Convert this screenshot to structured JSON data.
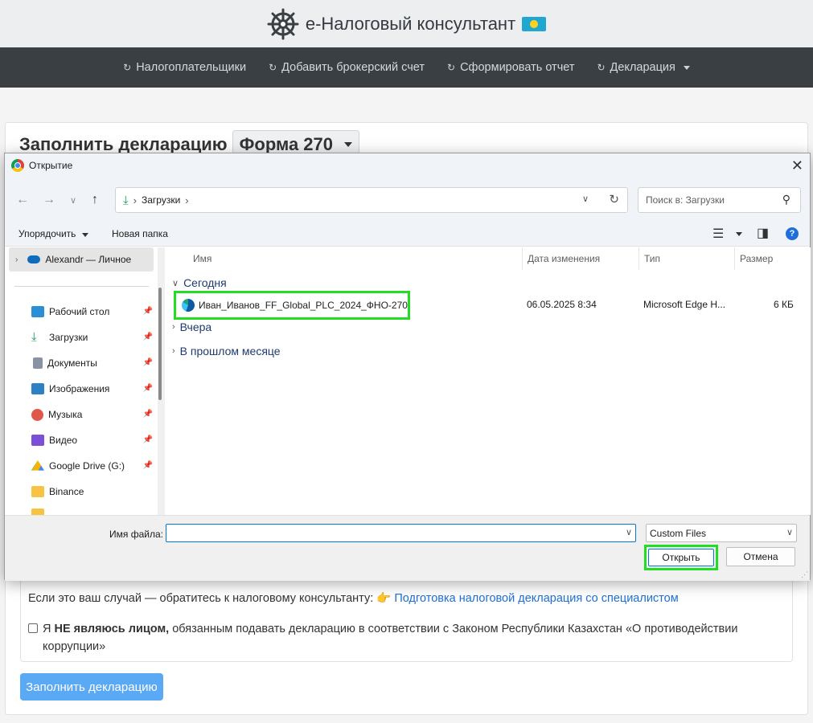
{
  "site": {
    "brand": "e-Налоговый консультант",
    "nav": [
      {
        "label": "Налогоплательщики"
      },
      {
        "label": "Добавить брокерский счет"
      },
      {
        "label": "Сформировать отчет"
      },
      {
        "label": "Декларация"
      }
    ],
    "page_title": "Заполнить декларацию",
    "form_select": "Форма 270",
    "info_text": "Если это ваш случай — обратитесь к налоговому консультанту: 👉",
    "info_link": "Подготовка налоговой декларация со специалистом",
    "checkbox_bold": "НЕ являюсь лицом,",
    "checkbox_prefix": "Я",
    "checkbox_text": "обязанным подавать декларацию в соответствии с Законом Республики Казахстан «О противодействии коррупции»",
    "submit_label": "Заполнить декларацию"
  },
  "dialog": {
    "title": "Открытие",
    "address_path": "Загрузки",
    "search_placeholder": "Поиск в: Загрузки",
    "organize_label": "Упорядочить",
    "new_folder_label": "Новая папка",
    "nav_pane": {
      "onedrive": "Alexandr — Личное",
      "items": [
        {
          "label": "Рабочий стол",
          "color": "#2b8fd6"
        },
        {
          "label": "Загрузки",
          "color": "#1a9d5f"
        },
        {
          "label": "Документы",
          "color": "#8a93a3"
        },
        {
          "label": "Изображения",
          "color": "#2f7fc5"
        },
        {
          "label": "Музыка",
          "color": "#e2574c"
        },
        {
          "label": "Видео",
          "color": "#7b4fd6"
        },
        {
          "label": "Google Drive (G:)",
          "color": "#f4b400"
        },
        {
          "label": "Binance",
          "color": "#f6c343"
        }
      ]
    },
    "columns": {
      "name": "Имя",
      "date": "Дата изменения",
      "type": "Тип",
      "size": "Размер"
    },
    "groups": {
      "today": "Сегодня",
      "yesterday": "Вчера",
      "last_month": "В прошлом месяце"
    },
    "file": {
      "name": "Иван_Иванов_FF_Global_PLC_2024_ФНО-270",
      "date": "06.05.2025 8:34",
      "type": "Microsoft Edge H...",
      "size": "6 КБ"
    },
    "filename_label": "Имя файла:",
    "filename_value": "",
    "filetype_value": "Custom Files",
    "open_label": "Открыть",
    "cancel_label": "Отмена"
  }
}
